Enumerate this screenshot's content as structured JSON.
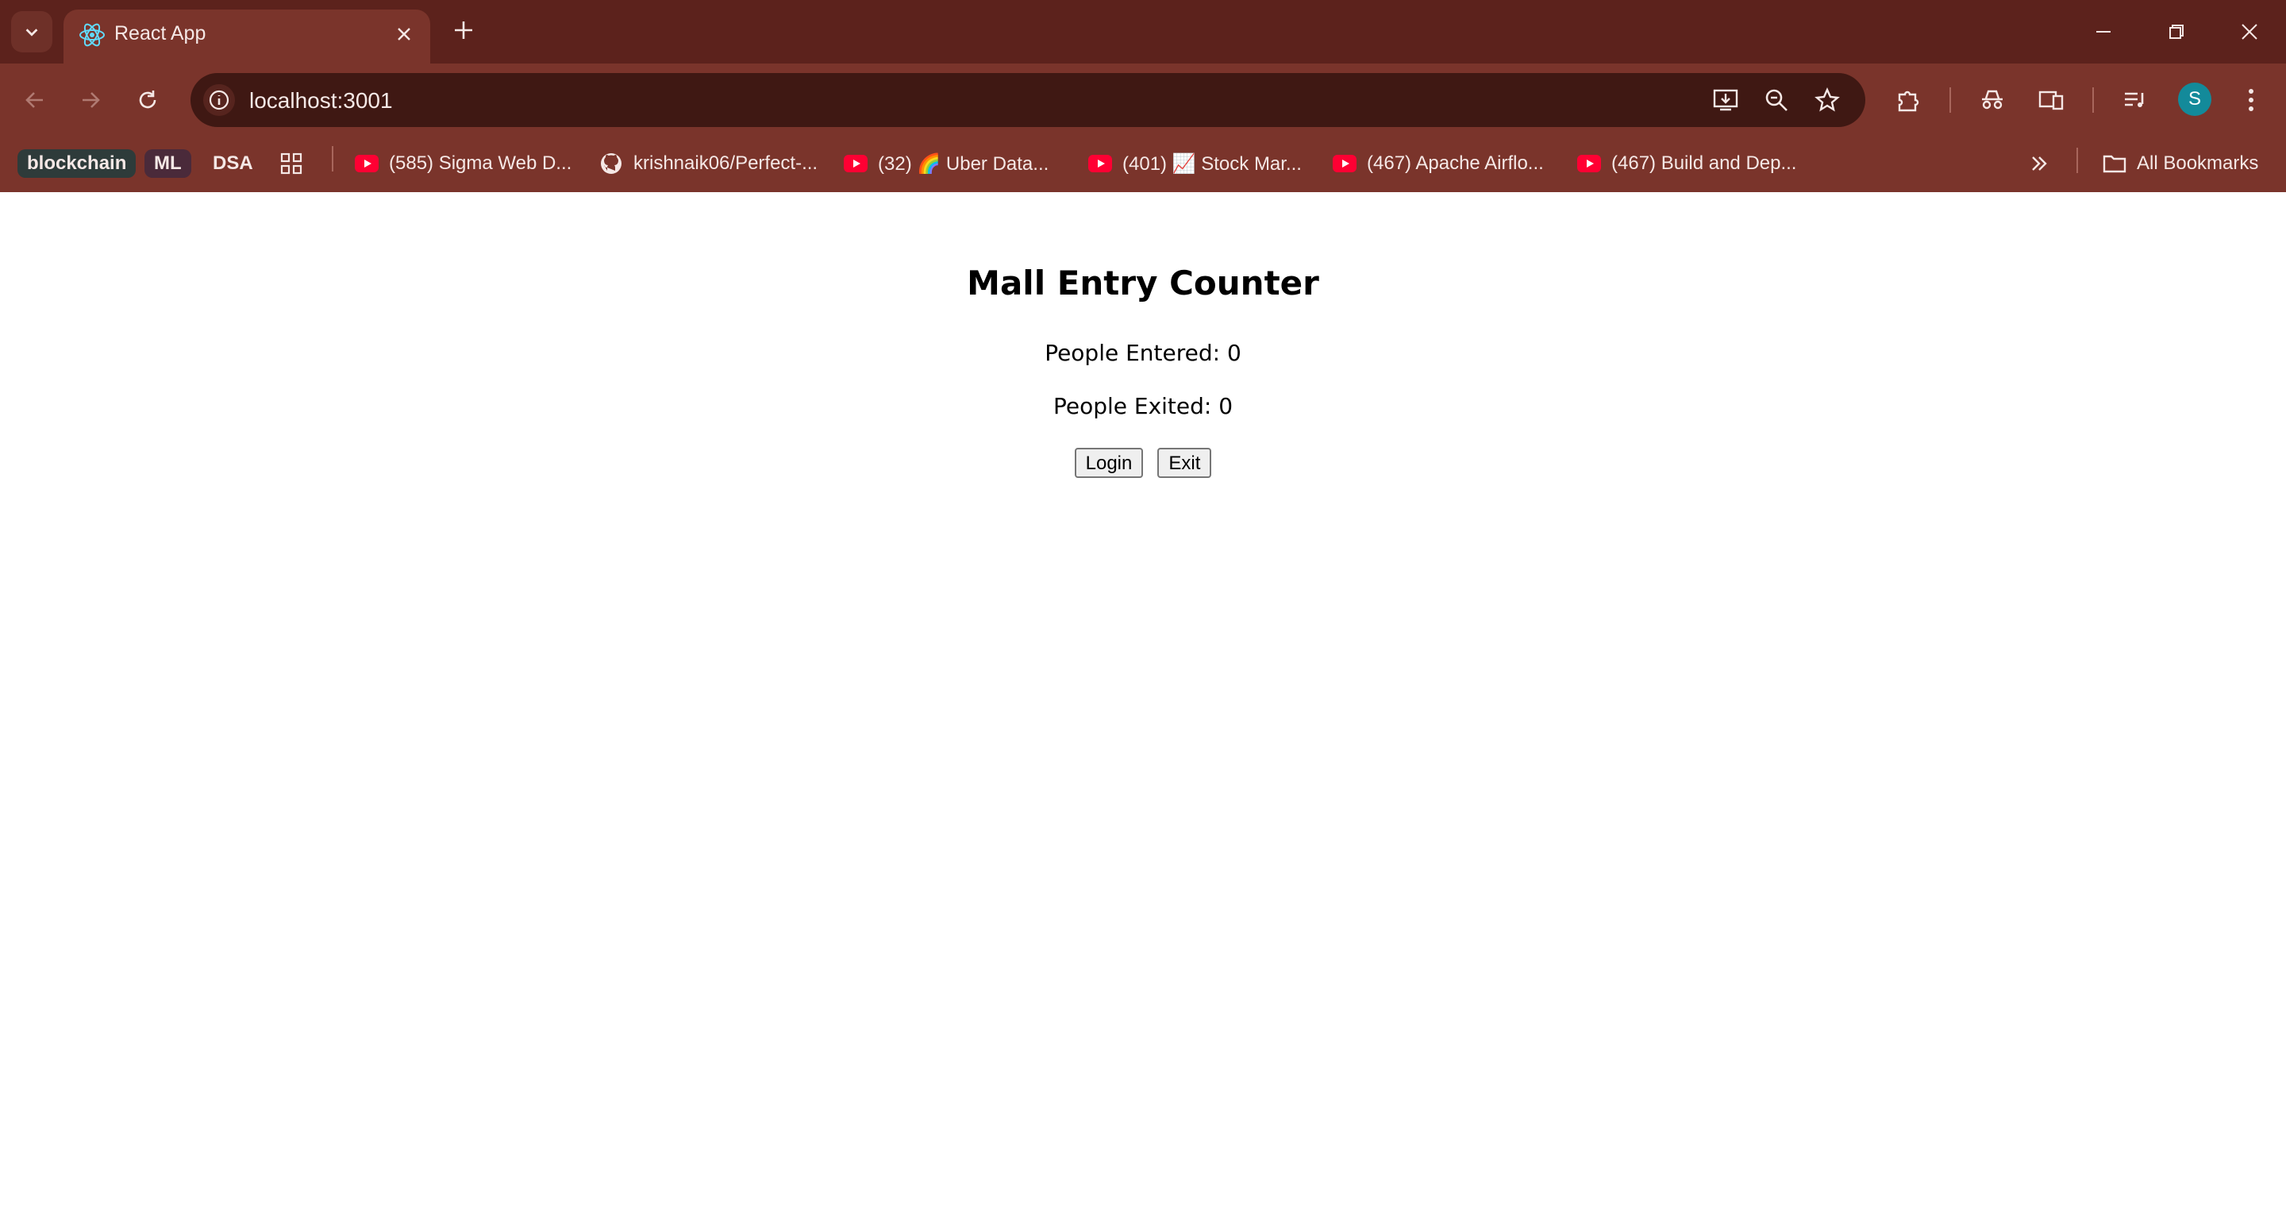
{
  "browser": {
    "tab": {
      "title": "React App",
      "favicon": "react-atom-icon"
    },
    "address_bar": {
      "url": "localhost:3001"
    },
    "profile_initial": "S",
    "bookmarks": [
      {
        "label": "blockchain",
        "type": "chip",
        "color": "#2e3b3a"
      },
      {
        "label": "ML",
        "type": "chip",
        "color": "#4a2a3a"
      },
      {
        "label": "DSA",
        "type": "text"
      },
      {
        "label": "(585) Sigma Web D...",
        "icon": "youtube-icon"
      },
      {
        "label": "krishnaik06/Perfect-...",
        "icon": "github-icon"
      },
      {
        "label": "(32) 🌈 Uber Data...",
        "icon": "youtube-icon"
      },
      {
        "label": "(401) 📈 Stock Mar...",
        "icon": "youtube-icon"
      },
      {
        "label": "(467) Apache Airflo...",
        "icon": "youtube-icon"
      },
      {
        "label": "(467) Build and Dep...",
        "icon": "youtube-icon"
      }
    ],
    "all_bookmarks_label": "All Bookmarks",
    "colors": {
      "frame": "#5c221c",
      "toolbar": "#7a342b",
      "omnibox": "#3f1813"
    }
  },
  "app": {
    "title": "Mall Entry Counter",
    "entered_text": "People Entered: 0",
    "exited_text": "People Exited: 0",
    "buttons": {
      "login": "Login",
      "exit": "Exit"
    }
  }
}
